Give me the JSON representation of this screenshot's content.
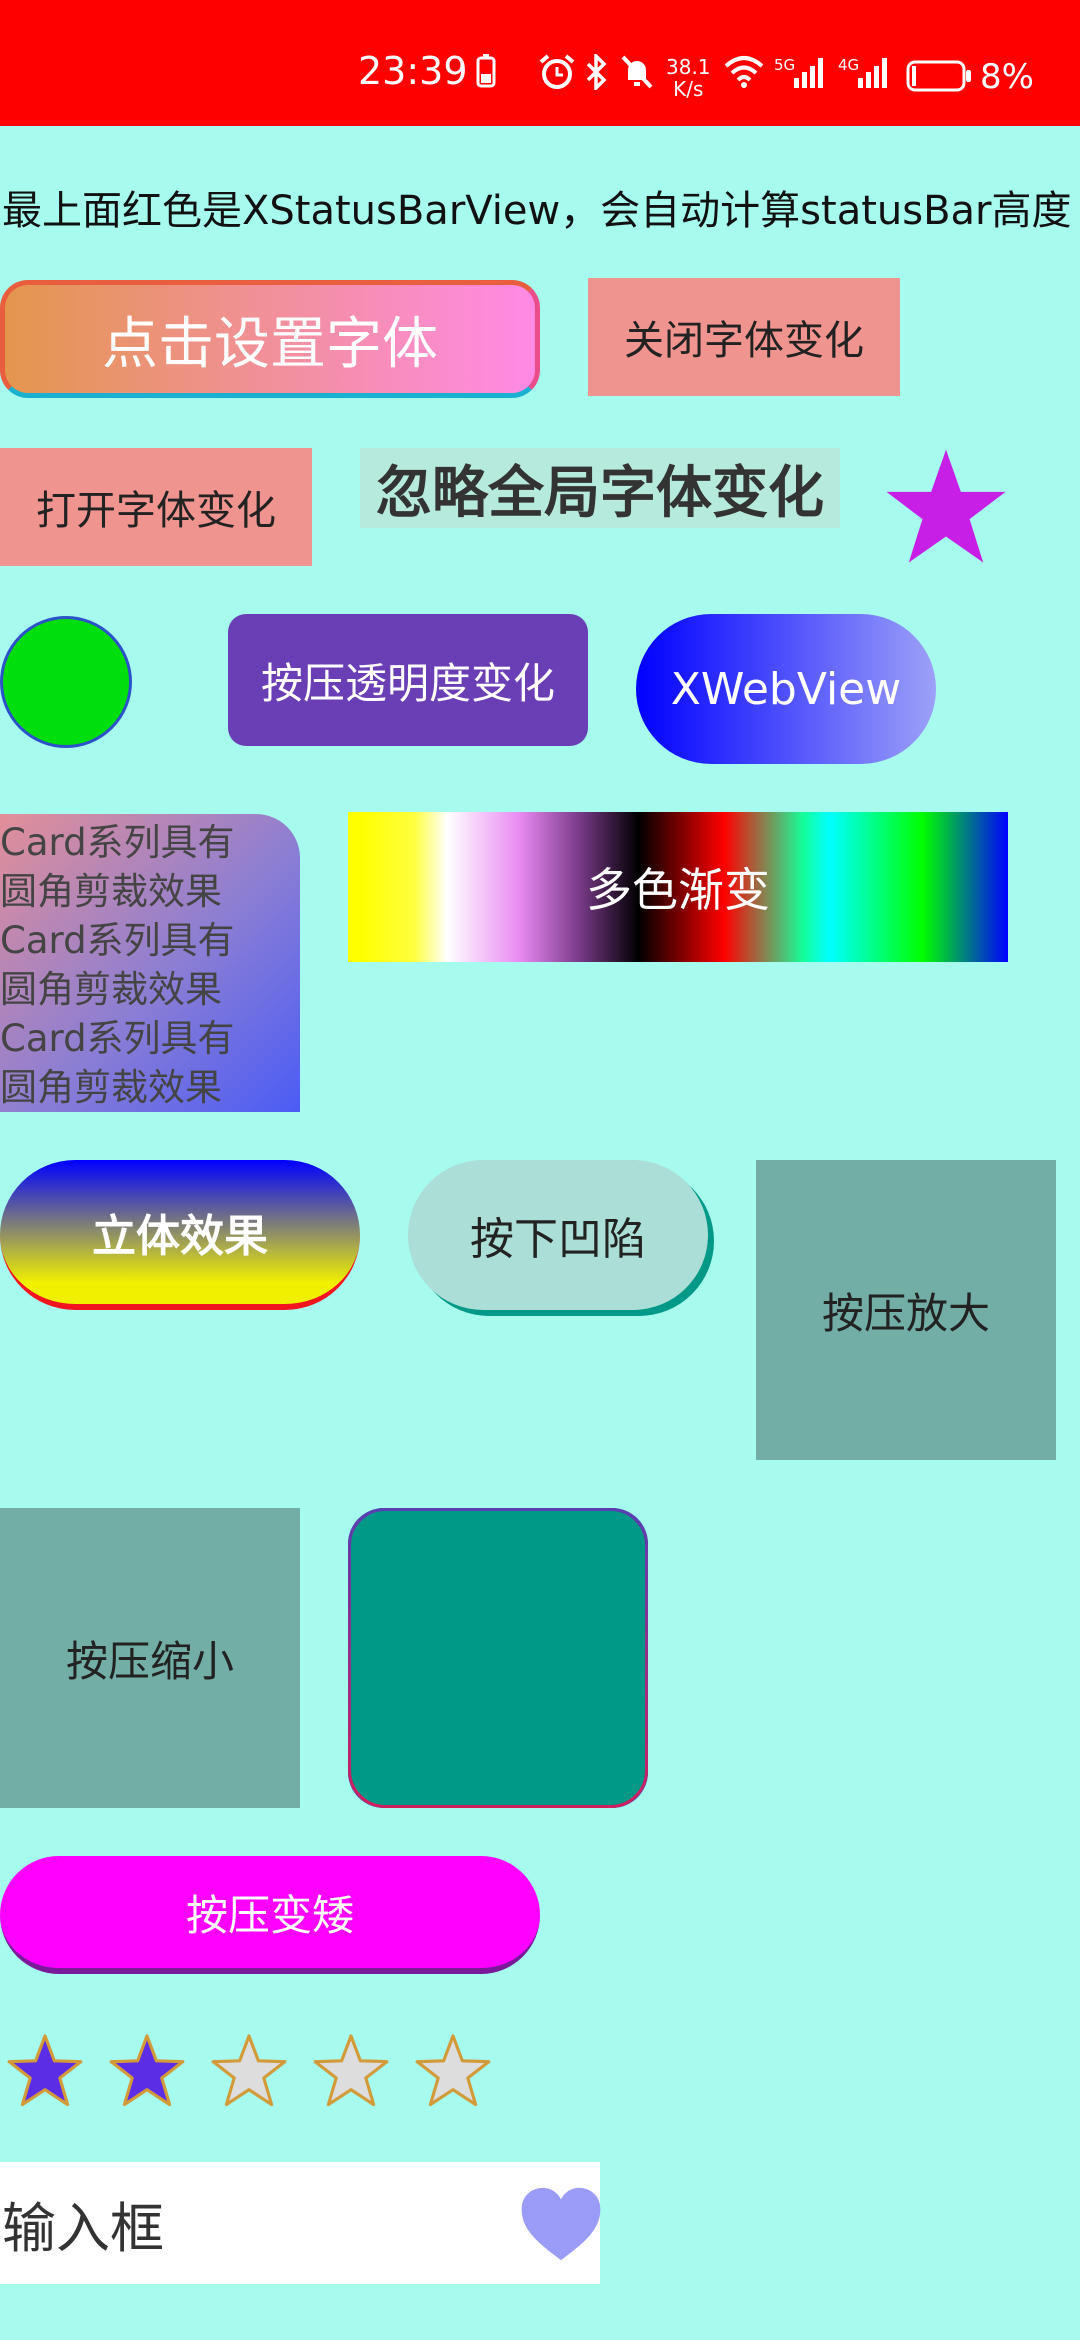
{
  "status_bar": {
    "time": "23:39",
    "speed_value": "38.1",
    "speed_unit": "K/s",
    "network_1": "5G",
    "network_2": "4G",
    "battery_pct": "8%",
    "bg_color": "#ff0000",
    "icons": [
      "battery-saver-icon",
      "alarm-icon",
      "bluetooth-icon",
      "mute-icon",
      "wifi-icon",
      "signal-icon",
      "signal-icon",
      "battery-icon"
    ]
  },
  "description": "最上面红色是XStatusBarView，会自动计算statusBar高度",
  "buttons": {
    "set_font": "点击设置字体",
    "close_font": "关闭字体变化",
    "open_font": "打开字体变化",
    "ignore_font": "忽略全局字体变化",
    "press_alpha": "按压透明度变化",
    "web_view": "XWebView",
    "multicolor": "多色渐变",
    "stereo": "立体效果",
    "press_sink": "按下凹陷",
    "press_enlarge": "按压放大",
    "press_shrink": "按压缩小",
    "press_shorten": "按压变矮"
  },
  "card": {
    "lines": [
      "Card系列具有",
      "圆角剪裁效果",
      "Card系列具有",
      "圆角剪裁效果",
      "Card系列具有",
      "圆角剪裁效果"
    ]
  },
  "rating": {
    "value": 2,
    "max": 5,
    "filled_color": "#5b2ee6",
    "empty_color": "#dddddd"
  },
  "input": {
    "value": "输入框",
    "icon": "heart-icon"
  },
  "colors": {
    "background": "#a6faee",
    "star_accent": "#c81fe6",
    "heart": "#9b9cf7"
  }
}
